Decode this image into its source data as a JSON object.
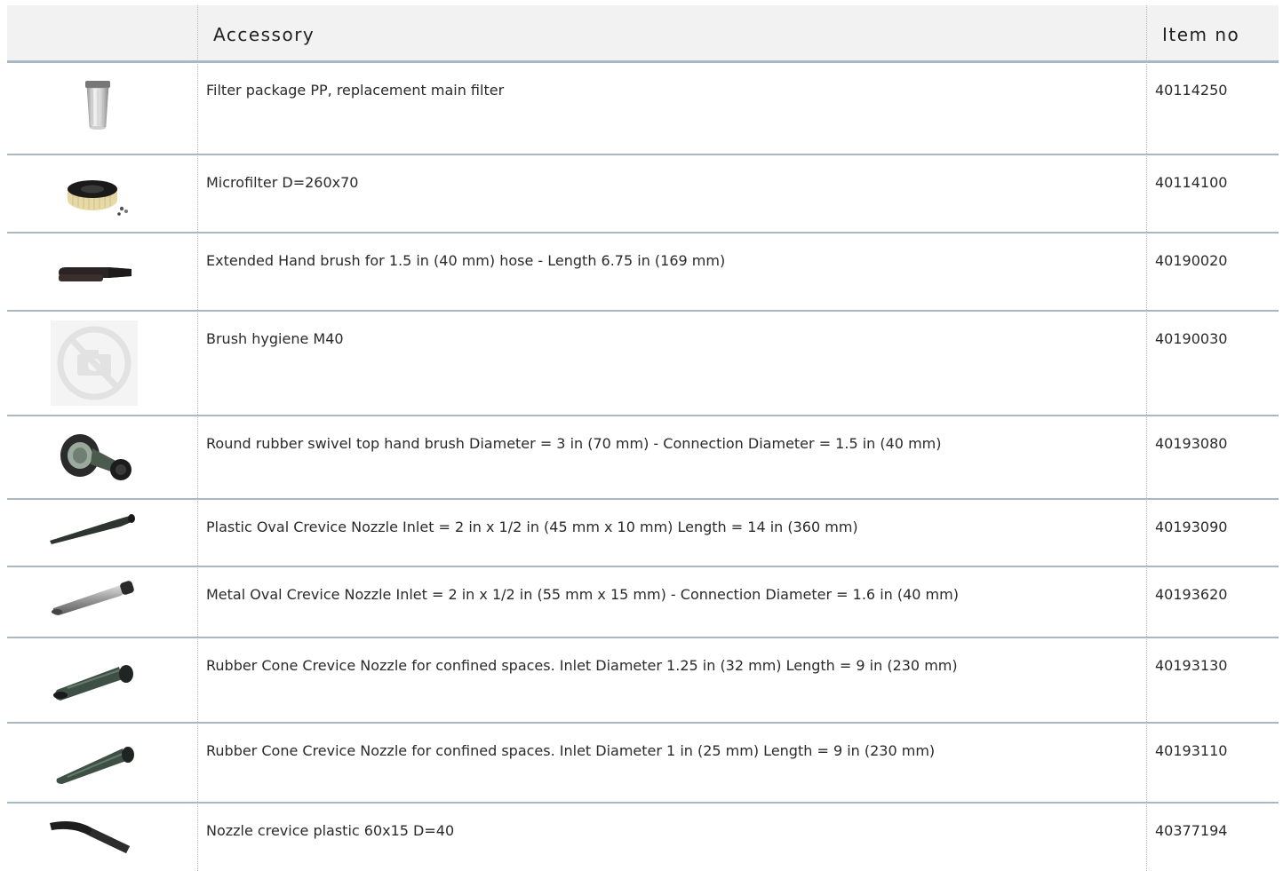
{
  "header": {
    "accessory_label": "Accessory",
    "item_no_label": "Item no"
  },
  "rows": [
    {
      "accessory": "Filter package PP, replacement main filter",
      "item_no": "40114250",
      "icon": "cylindrical-filter-icon"
    },
    {
      "accessory": "Microfilter D=260x70",
      "item_no": "40114100",
      "icon": "round-microfilter-icon"
    },
    {
      "accessory": "Extended Hand brush for 1.5 in (40 mm) hose - Length 6.75 in (169 mm)",
      "item_no": "40190020",
      "icon": "hand-brush-icon"
    },
    {
      "accessory": "Brush hygiene M40",
      "item_no": "40190030",
      "icon": "no-image-placeholder-icon"
    },
    {
      "accessory": "Round rubber swivel top hand brush Diameter = 3 in (70 mm) - Connection Diameter = 1.5 in (40 mm)",
      "item_no": "40193080",
      "icon": "swivel-brush-icon"
    },
    {
      "accessory": "Plastic Oval Crevice Nozzle Inlet = 2 in x 1/2 in (45 mm x 10 mm) Length = 14 in (360 mm)",
      "item_no": "40193090",
      "icon": "plastic-crevice-nozzle-icon"
    },
    {
      "accessory": "Metal Oval Crevice Nozzle Inlet = 2 in x 1/2 in (55 mm x 15 mm) - Connection Diameter = 1.6 in (40 mm)",
      "item_no": "40193620",
      "icon": "metal-crevice-nozzle-icon"
    },
    {
      "accessory": "Rubber Cone Crevice Nozzle for confined spaces. Inlet Diameter 1.25 in (32 mm) Length = 9 in (230 mm)",
      "item_no": "40193130",
      "icon": "rubber-cone-nozzle-icon"
    },
    {
      "accessory": "Rubber Cone Crevice Nozzle for confined spaces. Inlet Diameter 1 in (25 mm) Length = 9 in (230 mm)",
      "item_no": "40193110",
      "icon": "rubber-cone-nozzle-small-icon"
    },
    {
      "accessory": "Nozzle crevice plastic 60x15 D=40",
      "item_no": "40377194",
      "icon": "curved-crevice-nozzle-icon"
    }
  ]
}
